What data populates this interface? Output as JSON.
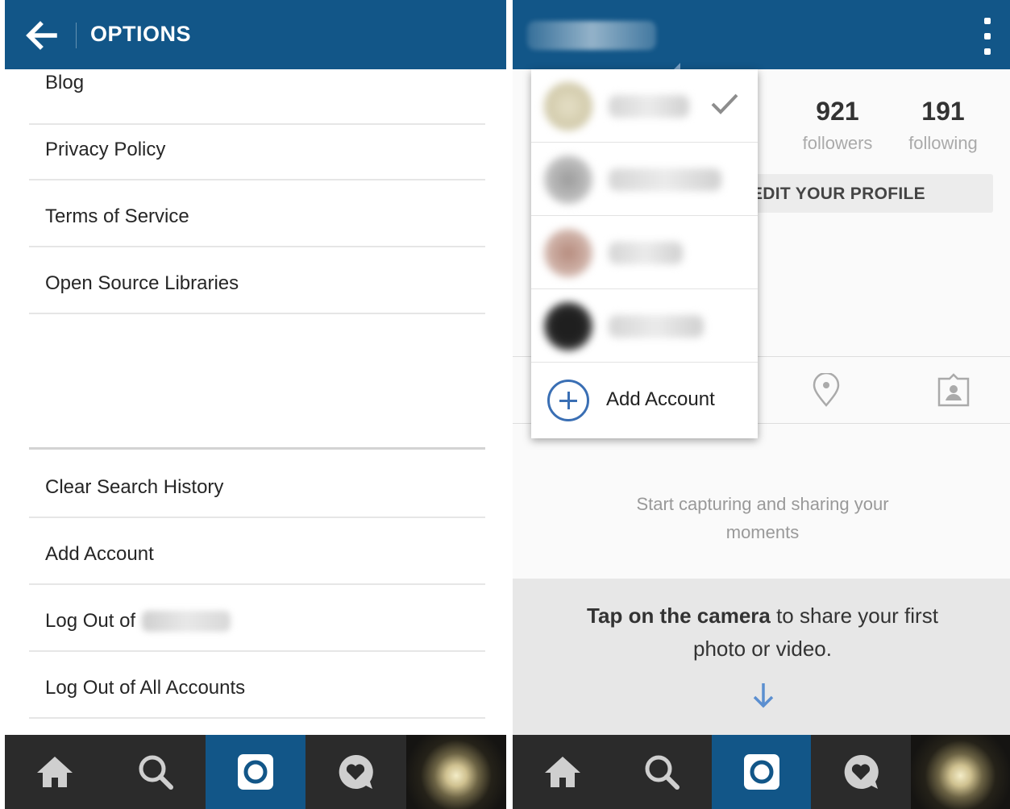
{
  "left_screen": {
    "header": {
      "title": "OPTIONS",
      "back_icon": "arrow-left-icon"
    },
    "options_group_1": [
      "Blog",
      "Privacy Policy",
      "Terms of Service",
      "Open Source Libraries"
    ],
    "options_group_2": [
      "Clear Search History",
      "Add Account",
      "Log Out of",
      "Log Out of All Accounts"
    ]
  },
  "right_screen": {
    "header": {
      "more_icon": "more-vertical-icon"
    },
    "stats": {
      "followers_count": "921",
      "followers_label": "followers",
      "following_count": "191",
      "following_label": "following"
    },
    "edit_profile_label": "EDIT YOUR PROFILE",
    "tabs": [
      "location-pin-icon",
      "tagged-person-icon"
    ],
    "empty_state": "Start capturing and sharing your moments",
    "prompt": {
      "bold": "Tap on the camera",
      "rest": " to share your first photo or video."
    },
    "account_switcher": {
      "selected_index": 0,
      "check_icon": "checkmark-icon",
      "add_account_label": "Add Account",
      "add_icon": "plus-circle-icon"
    }
  },
  "bottom_nav": {
    "items": [
      "home-icon",
      "search-icon",
      "camera-icon",
      "activity-heart-icon",
      "profile-photo"
    ],
    "active_index": 2
  },
  "colors": {
    "brand_blue": "#125688",
    "nav_dark": "#2b2b2b",
    "accent_blue": "#3a6fb4"
  }
}
